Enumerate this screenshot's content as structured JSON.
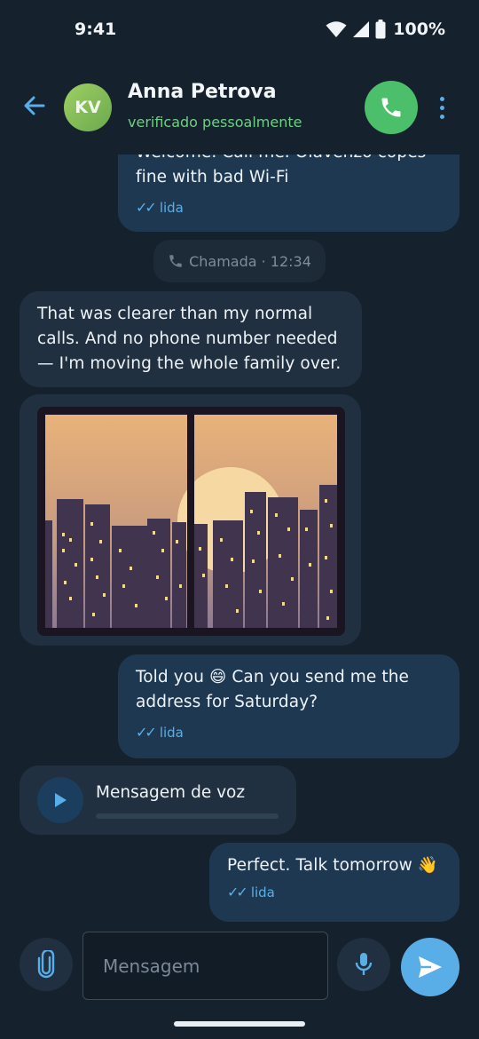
{
  "status_bar": {
    "time": "9:41",
    "battery": "100%"
  },
  "header": {
    "avatar_initials": "KV",
    "contact_name": "Anna Petrova",
    "contact_status": "verificado pessoalmente"
  },
  "messages": [
    {
      "direction": "out",
      "text_line1": "Welcome. Call me. Olavenzo copes",
      "text_line2": "fine with bad Wi-Fi",
      "status": "lida"
    },
    {
      "direction": "system",
      "text": "Chamada · 12:34"
    },
    {
      "direction": "in",
      "text_line1": "That was clearer than my normal",
      "text_line2": "calls. And no phone number needed",
      "text_line3": "— I'm moving the whole family over."
    },
    {
      "direction": "in",
      "type": "image"
    },
    {
      "direction": "out",
      "text_line1": "Told you 😄 Can you send me the",
      "text_line2": "address for Saturday?",
      "status": "lida"
    },
    {
      "direction": "in",
      "type": "voice",
      "label": "Mensagem de voz"
    },
    {
      "direction": "out",
      "text": "Perfect. Talk tomorrow 👋",
      "status": "lida"
    }
  ],
  "composer": {
    "placeholder": "Mensagem"
  },
  "colors": {
    "accent": "#5aaee8",
    "call": "#4cbf6a",
    "verified": "#6fcf86",
    "outgoing": "#1f3852",
    "incoming": "#213040"
  },
  "icons": [
    "back-arrow-icon",
    "phone-icon",
    "more-vertical-icon",
    "double-check-icon",
    "phone-small-icon",
    "play-icon",
    "paperclip-icon",
    "mic-icon",
    "send-icon",
    "wifi-icon",
    "signal-icon",
    "battery-icon"
  ]
}
